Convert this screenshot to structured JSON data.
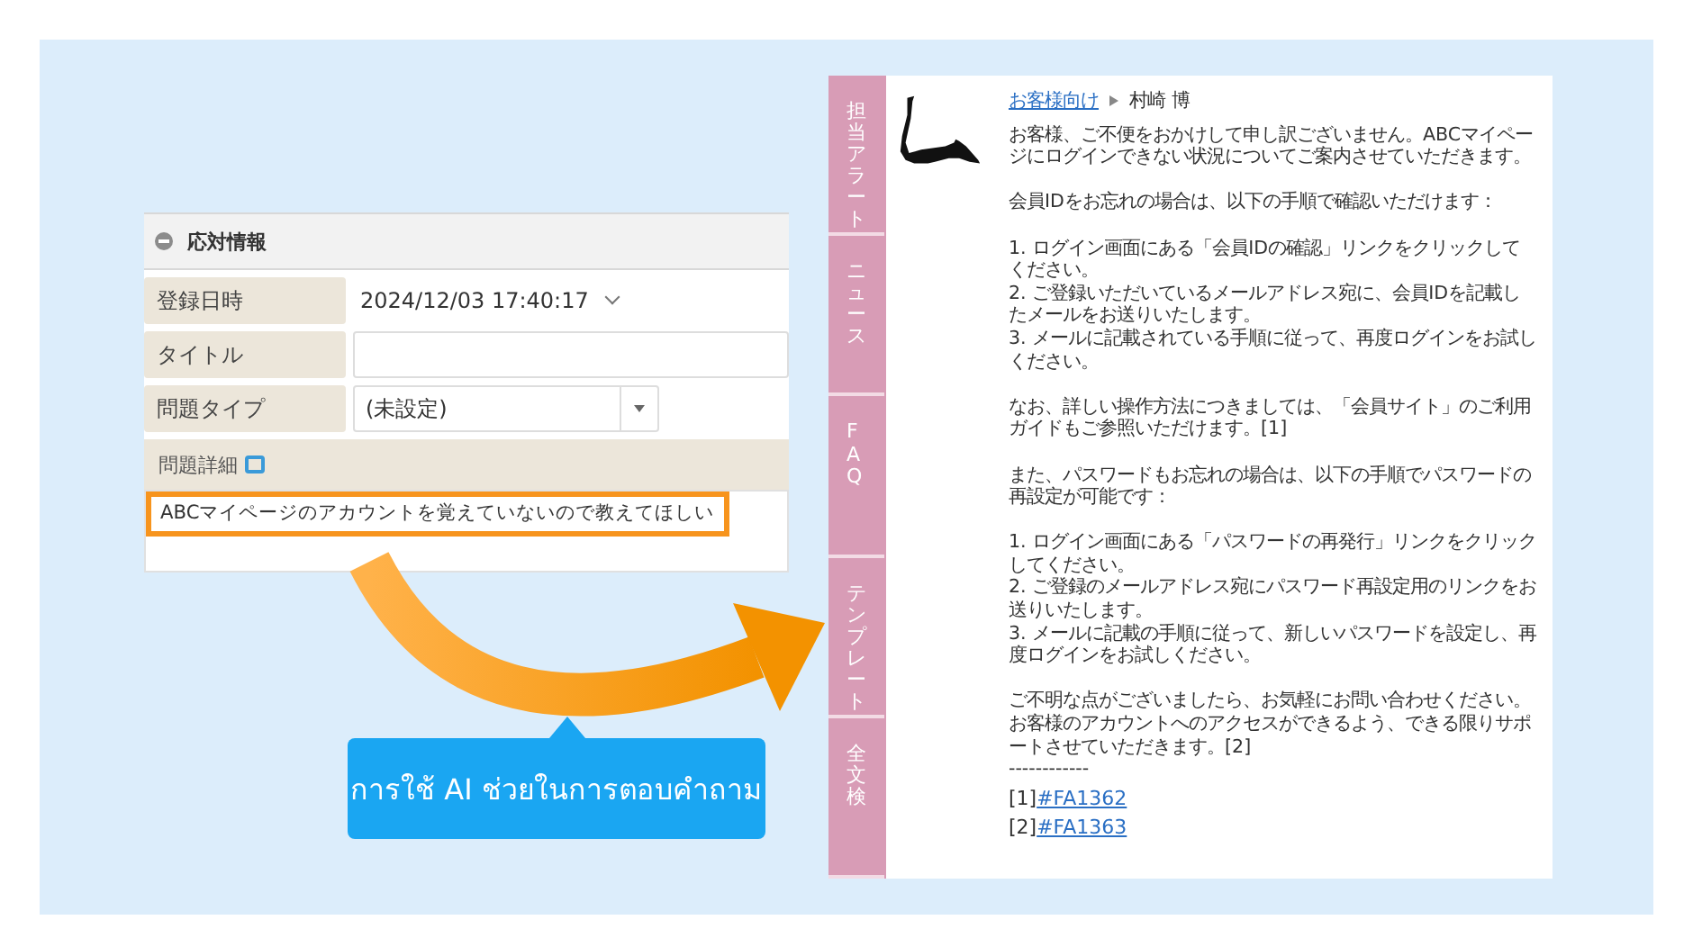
{
  "form": {
    "header": "応対情報",
    "fields": [
      {
        "kind": "datetime",
        "label": "登録日時",
        "value": "2024/12/03 17:40:17"
      },
      {
        "kind": "text",
        "label": "タイトル"
      },
      {
        "kind": "select",
        "label": "問題タイプ",
        "value": "(未設定)"
      }
    ],
    "detail": {
      "label": "問題詳細",
      "text": "ABCマイページのアカウントを覚えていないので教えてほしい"
    }
  },
  "panel": {
    "tabs": [
      "担当アラート",
      "ニュース",
      "FAQ",
      "テンプレート",
      "全文検"
    ],
    "breadcrumb": {
      "link": "お客様向け",
      "current": "村崎 博"
    },
    "paragraphs": [
      [
        "お客様、ご不便をおかけして申し訳ございません。ABCマイページにログインできない状況についてご案内させていただきます。"
      ],
      [
        "会員IDをお忘れの場合は、以下の手順で確認いただけます："
      ],
      [
        "1. ログイン画面にある「会員IDの確認」リンクをクリックしてください。",
        "2. ご登録いただいているメールアドレス宛に、会員IDを記載したメールをお送りいたします。",
        "3. メールに記載されている手順に従って、再度ログインをお試しください。"
      ],
      [
        "なお、詳しい操作方法につきましては、「会員サイト」のご利用ガイドもご参照いただけます。[1]"
      ],
      [
        "また、パスワードもお忘れの場合は、以下の手順でパスワードの再設定が可能です："
      ],
      [
        "1. ログイン画面にある「パスワードの再発行」リンクをクリックしてください。",
        "2. ご登録のメールアドレス宛にパスワード再設定用のリンクをお送りいたします。",
        "3. メールに記載の手順に従って、新しいパスワードを設定し、再度ログインをお試しください。"
      ],
      [
        "ご不明な点がございましたら、お気軽にお問い合わせください。",
        "お客様のアカウントへのアクセスができるよう、できる限りサポートさせていただきます。[2]"
      ]
    ],
    "separator": "------------",
    "references": [
      {
        "mark": "[1]",
        "link": "#FA1362"
      },
      {
        "mark": "[2]",
        "link": "#FA1363"
      }
    ]
  },
  "callout": {
    "text": "การใช้ AI ช่วยในการตอบคำถาม"
  }
}
